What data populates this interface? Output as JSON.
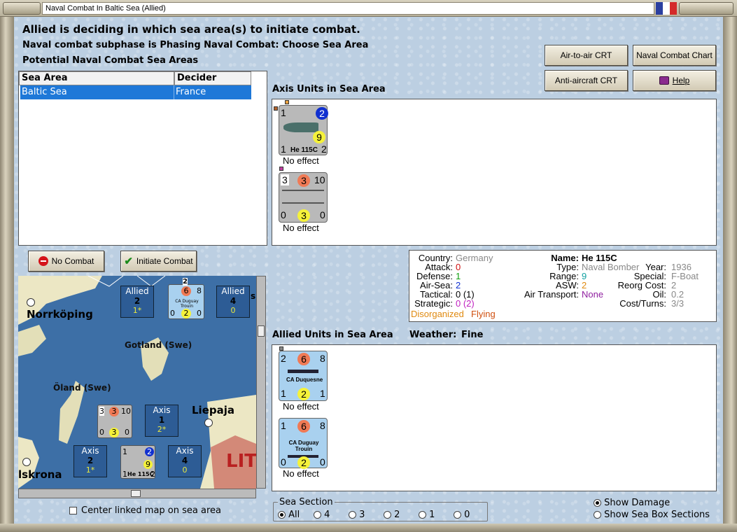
{
  "window": {
    "title": "Naval Combat In Baltic Sea (Allied)"
  },
  "header": {
    "line1": "Allied is deciding in which sea area(s) to initiate combat.",
    "line2": "Naval combat subphase is Phasing Naval Combat: Choose Sea Area",
    "line3": "Potential Naval Combat Sea Areas"
  },
  "buttons": {
    "air_to_air": "Air-to-air CRT",
    "naval_chart": "Naval Combat Chart",
    "anti_aircraft": "Anti-aircraft CRT",
    "help": "Help",
    "no_combat": "No Combat",
    "initiate_combat": "Initiate Combat"
  },
  "sea_table": {
    "columns": [
      "Sea Area",
      "Decider"
    ],
    "rows": [
      [
        "Baltic Sea",
        "France"
      ]
    ]
  },
  "axis_units": {
    "label": "Axis Units in Sea Area",
    "units": [
      {
        "top_left": "1",
        "top_right": "2",
        "mid": "9",
        "bot_left": "1",
        "bot_right": "2",
        "name": "He 115C",
        "effect": "No effect"
      },
      {
        "top_left": "3",
        "top_mid": "3",
        "top_right": "10",
        "bot_left": "0",
        "bot_mid": "3",
        "bot_right": "0",
        "effect": "No effect"
      }
    ]
  },
  "info": {
    "country_lbl": "Country:",
    "country": "Germany",
    "attack_lbl": "Attack:",
    "attack": "0",
    "defense_lbl": "Defense:",
    "defense": "1",
    "airsea_lbl": "Air-Sea:",
    "airsea": "2",
    "tactical_lbl": "Tactical:",
    "tactical": "0 (1)",
    "strategic_lbl": "Strategic:",
    "strategic": "0 (2)",
    "status1": "Disorganized",
    "status2": "Flying",
    "name_lbl": "Name:",
    "name": "He 115C",
    "type_lbl": "Type:",
    "type": "Naval Bomber",
    "range_lbl": "Range:",
    "range": "9",
    "asw_lbl": "ASW:",
    "asw": "2",
    "airtrans_lbl": "Air Transport:",
    "airtrans": "None",
    "year_lbl": "Year:",
    "year": "1936",
    "special_lbl": "Special:",
    "special": "F-Boat",
    "reorg_lbl": "Reorg Cost:",
    "reorg": "2",
    "oil_lbl": "Oil:",
    "oil": "0.2",
    "cost_lbl": "Cost/Turns:",
    "cost": "3/3"
  },
  "allied_units": {
    "label": "Allied Units in Sea Area",
    "weather_lbl": "Weather:",
    "weather": "Fine",
    "units": [
      {
        "top_left": "2",
        "top_mid": "6",
        "top_right": "8",
        "name": "CA Duquesne",
        "bot_left": "1",
        "bot_mid": "2",
        "bot_right": "1",
        "effect": "No effect"
      },
      {
        "top_left": "1",
        "top_mid": "6",
        "top_right": "8",
        "name": "CA Duguay Trouin",
        "bot_left": "0",
        "bot_mid": "2",
        "bot_right": "0",
        "effect": "No effect"
      }
    ]
  },
  "map": {
    "labels": {
      "norrkoping": "Norrköping",
      "gotland": "Gotland (Swe)",
      "oland": "Öland (Swe)",
      "liepaja": "Liepaja",
      "karlskrona": "lskrona",
      "lit": "LIT"
    },
    "boxes": [
      {
        "side": "Allied",
        "num": "2",
        "sub": "1*"
      },
      {
        "side": "Allied",
        "num": "4",
        "sub": "0"
      },
      {
        "side": "Axis",
        "num": "1",
        "sub": "2*"
      },
      {
        "side": "Axis",
        "num": "2",
        "sub": "1*"
      },
      {
        "side": "Axis",
        "num": "4",
        "sub": "0"
      }
    ],
    "mini_counters": {
      "ca_top": "2",
      "ca_a": "6",
      "ca_b": "8",
      "ca_c": "0",
      "ca_d": "2",
      "ca_e": "0",
      "ca_name": "CA Duguay Trouin",
      "bb_a": "3",
      "bb_b": "3",
      "bb_c": "10",
      "bb_d": "0",
      "bb_e": "3",
      "bb_f": "0",
      "he_a": "1",
      "he_b": "2",
      "he_c": "9",
      "he_d": "1",
      "he_name": "He 115C",
      "he_e": "2",
      "s_label": "s"
    }
  },
  "center_link": "Center linked map on sea area",
  "sea_section": {
    "label": "Sea Section",
    "options": [
      "All",
      "4",
      "3",
      "2",
      "1",
      "0"
    ],
    "selected": "All"
  },
  "display_options": {
    "show_damage": "Show Damage",
    "show_sea_box": "Show Sea Box Sections",
    "selected": "Show Damage"
  },
  "colors": {
    "selection": "#1e78d8",
    "axis_counter": "#b9b9b9",
    "allied_counter": "#a9d1ef",
    "sea": "#3d6fa6",
    "land": "#ece7c4"
  }
}
